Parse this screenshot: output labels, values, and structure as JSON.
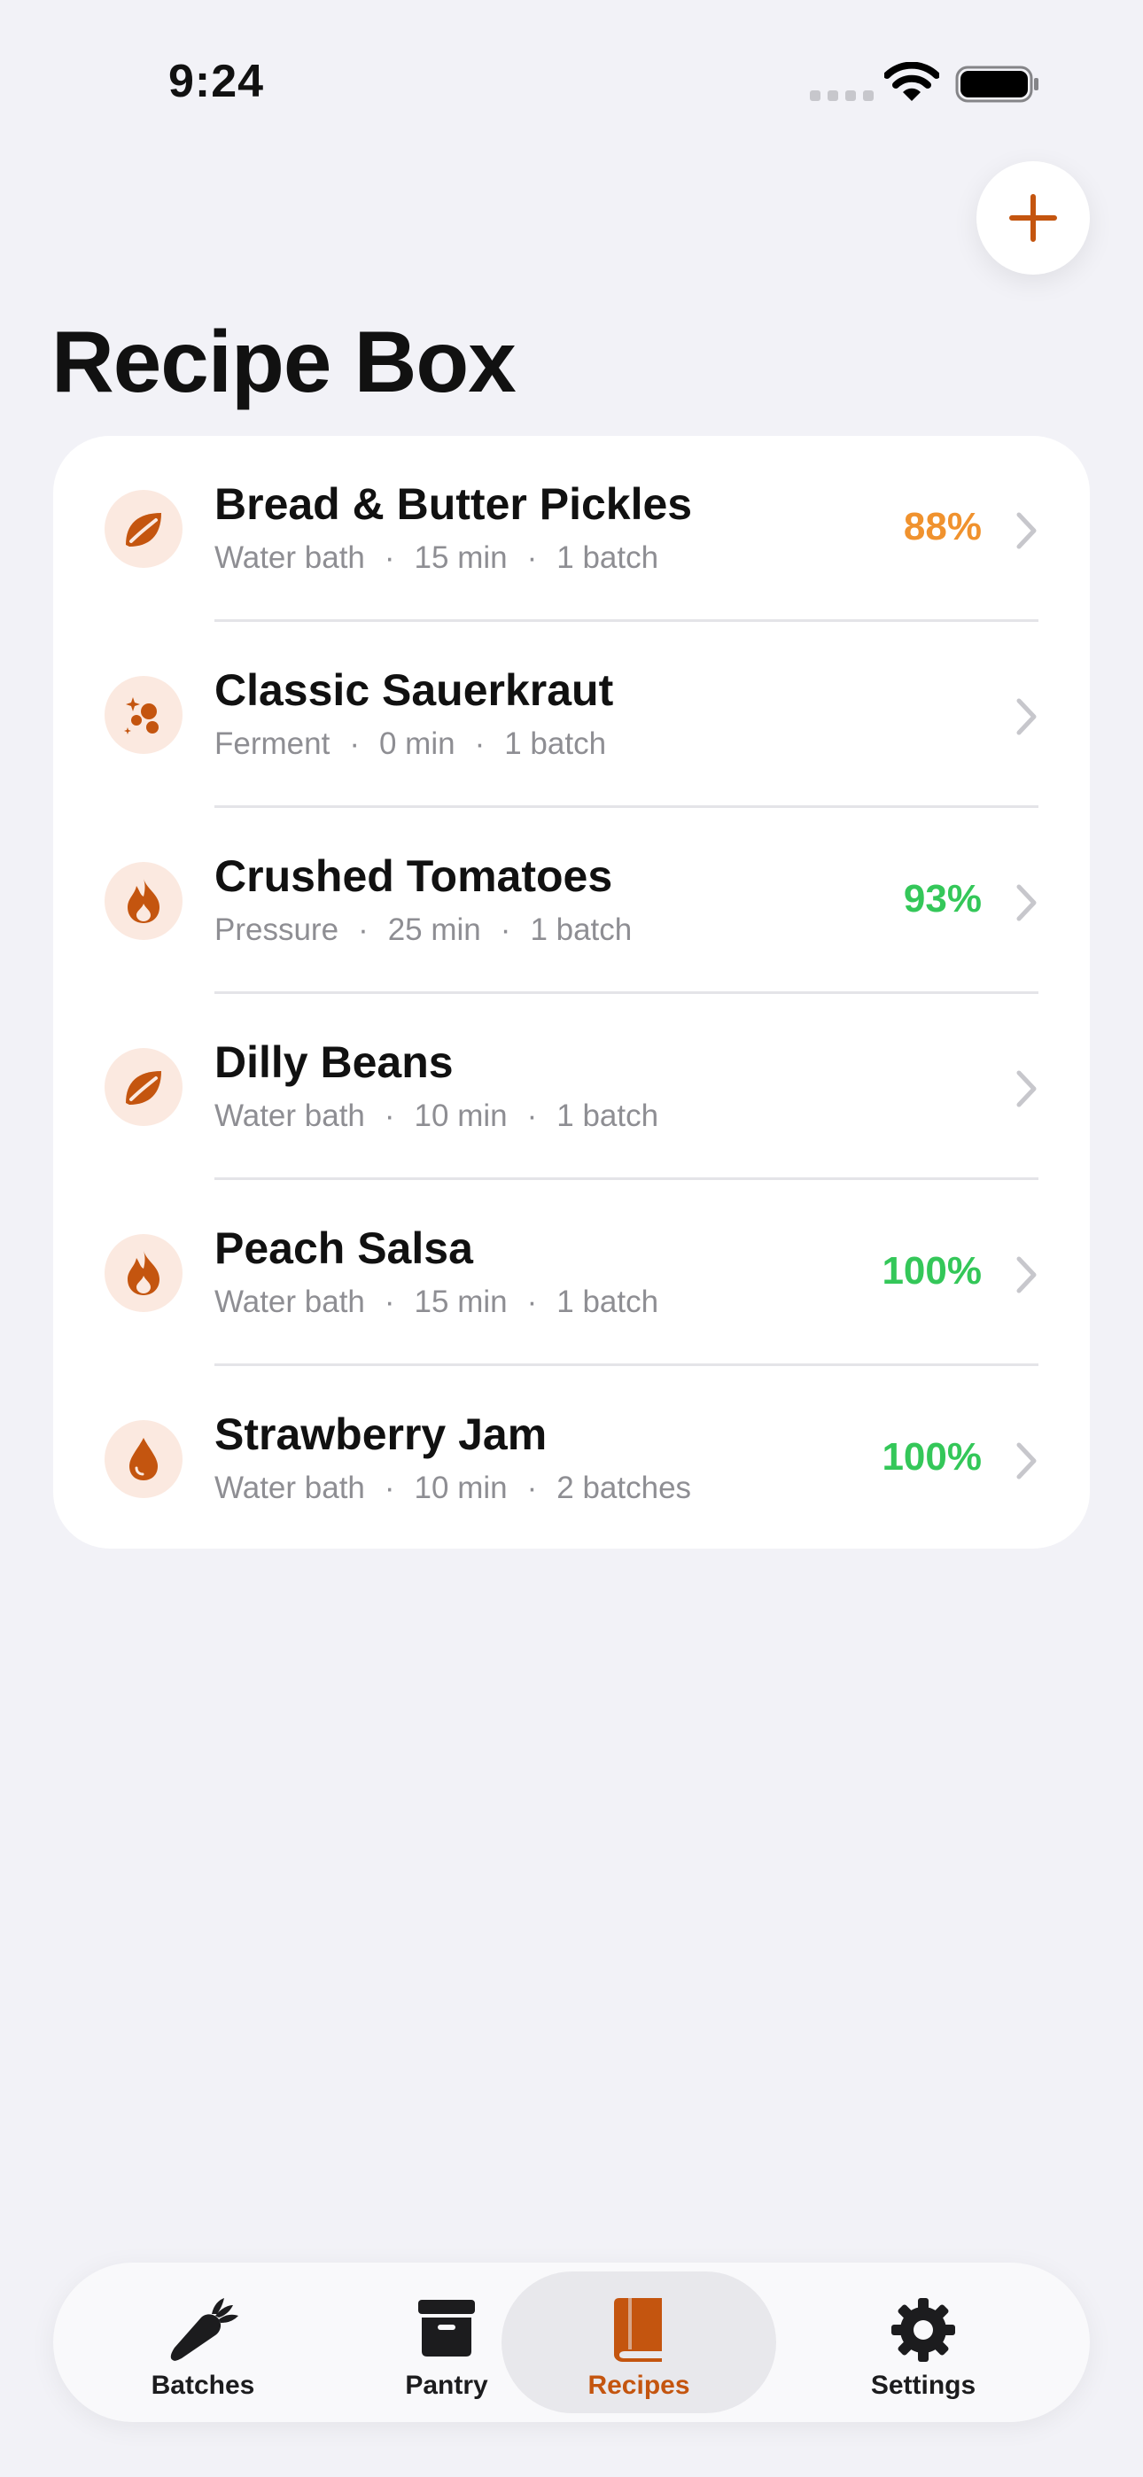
{
  "status_bar": {
    "time": "9:24"
  },
  "page": {
    "title": "Recipe Box"
  },
  "colors": {
    "accent": "#C4550F",
    "icon_bg": "#FBE9E0",
    "pct_warn": "#F0922E",
    "pct_good": "#34C759"
  },
  "recipes": [
    {
      "name": "Bread & Butter Pickles",
      "method": "Water bath",
      "time": "15 min",
      "yield": "1 batch",
      "percent": "88%",
      "percent_color": "#F0922E",
      "icon": "leaf-icon"
    },
    {
      "name": "Classic Sauerkraut",
      "method": "Ferment",
      "time": "0 min",
      "yield": "1 batch",
      "percent": "",
      "percent_color": "",
      "icon": "bubbles-icon"
    },
    {
      "name": "Crushed Tomatoes",
      "method": "Pressure",
      "time": "25 min",
      "yield": "1 batch",
      "percent": "93%",
      "percent_color": "#34C759",
      "icon": "flame-icon"
    },
    {
      "name": "Dilly Beans",
      "method": "Water bath",
      "time": "10 min",
      "yield": "1 batch",
      "percent": "",
      "percent_color": "",
      "icon": "leaf-icon"
    },
    {
      "name": "Peach Salsa",
      "method": "Water bath",
      "time": "15 min",
      "yield": "1 batch",
      "percent": "100%",
      "percent_color": "#34C759",
      "icon": "flame-icon"
    },
    {
      "name": "Strawberry Jam",
      "method": "Water bath",
      "time": "10 min",
      "yield": "2 batches",
      "percent": "100%",
      "percent_color": "#34C759",
      "icon": "drop-icon"
    }
  ],
  "tabs": [
    {
      "label": "Batches",
      "icon": "carrot-icon",
      "active": false
    },
    {
      "label": "Pantry",
      "icon": "archive-box-icon",
      "active": false
    },
    {
      "label": "Recipes",
      "icon": "book-icon",
      "active": true
    },
    {
      "label": "Settings",
      "icon": "gear-icon",
      "active": false
    }
  ]
}
